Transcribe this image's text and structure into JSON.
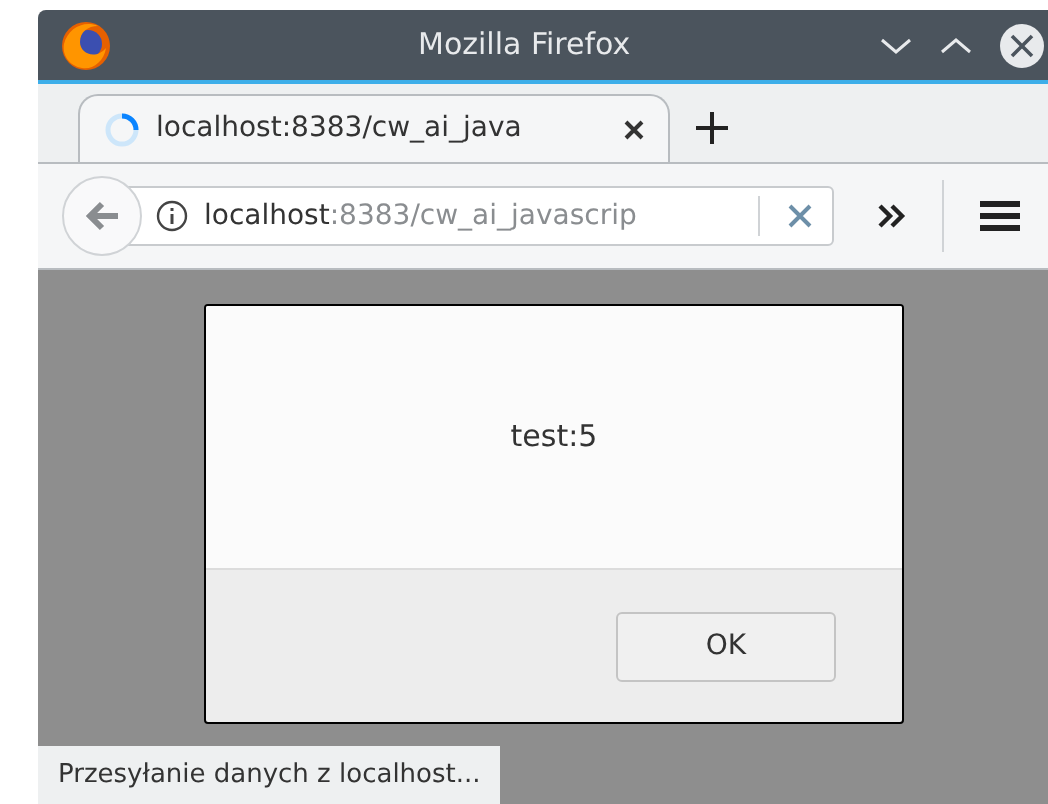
{
  "window": {
    "title": "Mozilla Firefox"
  },
  "tabs": [
    {
      "label": "localhost:8383/cw_ai_java",
      "selected": true,
      "loading": true
    }
  ],
  "address_bar": {
    "host": "localhost",
    "path": ":8383/cw_ai_javascrip"
  },
  "dialog": {
    "message": "test:5",
    "buttons": [
      "OK"
    ]
  },
  "status_bar": {
    "text": "Przesyłanie danych z localhost..."
  }
}
